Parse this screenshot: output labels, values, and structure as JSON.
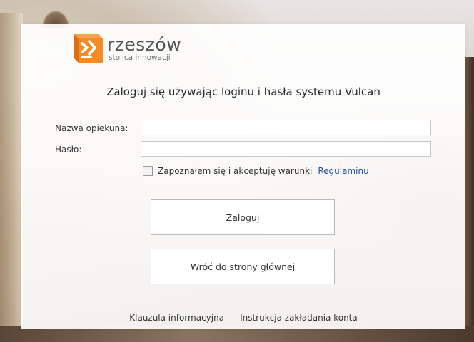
{
  "logo": {
    "name": "rzeszów",
    "tagline": "stolica innowacji",
    "colors": {
      "orange": "#f28c28",
      "orange_dark": "#e06f12",
      "text": "#545454"
    }
  },
  "heading": "Zaloguj się używając loginu i hasła systemu Vulcan",
  "form": {
    "username_label": "Nazwa opiekuna:",
    "username_value": "",
    "password_label": "Hasło:",
    "password_value": ""
  },
  "terms": {
    "checked": false,
    "text": "Zapoznałem się i akceptuję warunki",
    "link_label": "Regulaminu"
  },
  "buttons": {
    "login": "Zaloguj",
    "back": "Wróć do strony głównej"
  },
  "footer": {
    "info_clause": "Klauzula informacyjna",
    "account_instructions": "Instrukcja zakładania konta"
  }
}
